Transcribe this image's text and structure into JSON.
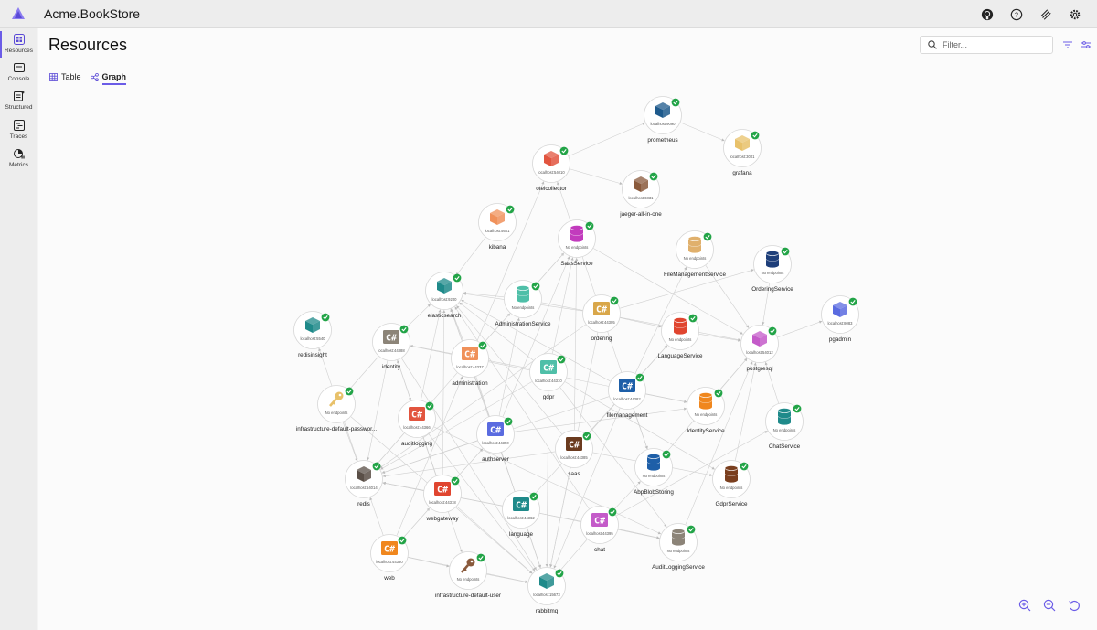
{
  "app": {
    "title": "Acme.BookStore"
  },
  "topbar": {
    "icons": [
      "github-icon",
      "help-icon",
      "feedback-icon",
      "settings-icon"
    ]
  },
  "sidebar": {
    "items": [
      {
        "label": "Resources",
        "icon": "resources-icon",
        "active": true
      },
      {
        "label": "Console",
        "icon": "console-icon",
        "active": false
      },
      {
        "label": "Structured",
        "icon": "structured-icon",
        "active": false
      },
      {
        "label": "Traces",
        "icon": "traces-icon",
        "active": false
      },
      {
        "label": "Metrics",
        "icon": "metrics-icon",
        "active": false
      }
    ]
  },
  "page": {
    "title": "Resources",
    "filter_placeholder": "Filter...",
    "tabs": [
      {
        "label": "Table",
        "icon": "table-icon",
        "active": false
      },
      {
        "label": "Graph",
        "icon": "graph-icon",
        "active": true
      }
    ]
  },
  "colors": {
    "accent": "#6b5ce7",
    "status_ok": "#22a447",
    "edge": "#d0d0d0"
  },
  "graph": {
    "nodes": [
      {
        "id": "prometheus",
        "label": "prometheus",
        "endpoint": "localhost:9090",
        "kind": "container",
        "color": "#1e5a8c"
      },
      {
        "id": "grafana",
        "label": "grafana",
        "endpoint": "localhost:3001",
        "kind": "container",
        "color": "#e8c16a"
      },
      {
        "id": "otelcollector",
        "label": "otelcollector",
        "endpoint": "localhost:54010",
        "kind": "container",
        "color": "#e2553f"
      },
      {
        "id": "jaeger",
        "label": "jaeger-all-in-one",
        "endpoint": "localhost:6831",
        "kind": "container",
        "color": "#8a5a3c"
      },
      {
        "id": "kibana",
        "label": "kibana",
        "endpoint": "localhost:5601",
        "kind": "container",
        "color": "#f0915a"
      },
      {
        "id": "saasservice",
        "label": "SaasService",
        "endpoint": "No endpoints",
        "kind": "database",
        "color": "#c23bbd"
      },
      {
        "id": "filemgmtsvc",
        "label": "FileManagementService",
        "endpoint": "No endpoints",
        "kind": "database",
        "color": "#e0b06c"
      },
      {
        "id": "orderingsvc",
        "label": "OrderingService",
        "endpoint": "No endpoints",
        "kind": "database",
        "color": "#1e3f7a"
      },
      {
        "id": "elasticsearch",
        "label": "elasticsearch",
        "endpoint": "localhost:9200",
        "kind": "container",
        "color": "#1f8a8a"
      },
      {
        "id": "adminsvc",
        "label": "AdministrationService",
        "endpoint": "No endpoints",
        "kind": "database",
        "color": "#4fbfa8"
      },
      {
        "id": "ordering",
        "label": "ordering",
        "endpoint": "localhost:44305",
        "kind": "project",
        "color": "#d9a74a"
      },
      {
        "id": "pgadmin",
        "label": "pgadmin",
        "endpoint": "localhost:8083",
        "kind": "container",
        "color": "#5a6be0"
      },
      {
        "id": "redisinsight",
        "label": "redisinsight",
        "endpoint": "localhost:5540",
        "kind": "container",
        "color": "#1f8a8a"
      },
      {
        "id": "identity",
        "label": "identity",
        "endpoint": "localhost:44388",
        "kind": "project",
        "color": "#8c8478"
      },
      {
        "id": "languagesvc",
        "label": "LanguageService",
        "endpoint": "No endpoints",
        "kind": "database",
        "color": "#e0452f"
      },
      {
        "id": "postgresql",
        "label": "postgresql",
        "endpoint": "localhost:54012",
        "kind": "container",
        "color": "#c45bc9"
      },
      {
        "id": "administration",
        "label": "administration",
        "endpoint": "localhost:44337",
        "kind": "project",
        "color": "#f0915a"
      },
      {
        "id": "gdpr",
        "label": "gdpr",
        "endpoint": "localhost:44310",
        "kind": "project",
        "color": "#4fbfa8"
      },
      {
        "id": "filemanagement",
        "label": "filemanagement",
        "endpoint": "localhost:44382",
        "kind": "project",
        "color": "#1e5fa8"
      },
      {
        "id": "infrapwd",
        "label": "infrastructure-default-passwor...",
        "endpoint": "No endpoints",
        "kind": "parameter",
        "color": "#e8c16a"
      },
      {
        "id": "identitysvc",
        "label": "IdentityService",
        "endpoint": "No endpoints",
        "kind": "database",
        "color": "#f0871e"
      },
      {
        "id": "chatsvc",
        "label": "ChatService",
        "endpoint": "No endpoints",
        "kind": "database",
        "color": "#1f8a8a"
      },
      {
        "id": "auditlogging",
        "label": "auditlogging",
        "endpoint": "localhost:44366",
        "kind": "project",
        "color": "#e2553f"
      },
      {
        "id": "authserver",
        "label": "authserver",
        "endpoint": "localhost:44350",
        "kind": "project",
        "color": "#5a6be0"
      },
      {
        "id": "saas",
        "label": "saas",
        "endpoint": "localhost:44385",
        "kind": "project",
        "color": "#6b3b1f"
      },
      {
        "id": "redis",
        "label": "redis",
        "endpoint": "localhost:54014",
        "kind": "container",
        "color": "#5a4f47"
      },
      {
        "id": "abpblob",
        "label": "AbpBlobStoring",
        "endpoint": "No endpoints",
        "kind": "database",
        "color": "#1e5fa8"
      },
      {
        "id": "gdprsvc",
        "label": "GdprService",
        "endpoint": "No endpoints",
        "kind": "database",
        "color": "#7a3f1f"
      },
      {
        "id": "webgateway",
        "label": "webgateway",
        "endpoint": "localhost:44318",
        "kind": "project",
        "color": "#e0452f"
      },
      {
        "id": "language",
        "label": "language",
        "endpoint": "localhost:44362",
        "kind": "project",
        "color": "#1f8a8a"
      },
      {
        "id": "chat",
        "label": "chat",
        "endpoint": "localhost:44395",
        "kind": "project",
        "color": "#c45bc9"
      },
      {
        "id": "auditsvc",
        "label": "AuditLoggingService",
        "endpoint": "No endpoints",
        "kind": "database",
        "color": "#8c8478"
      },
      {
        "id": "web",
        "label": "web",
        "endpoint": "localhost:44380",
        "kind": "project",
        "color": "#f0871e"
      },
      {
        "id": "infrauser",
        "label": "infrastructure-default-user",
        "endpoint": "No endpoints",
        "kind": "parameter",
        "color": "#8a5a3c"
      },
      {
        "id": "rabbitmq",
        "label": "rabbitmq",
        "endpoint": "localhost:15673",
        "kind": "container",
        "color": "#1f8a8a"
      }
    ],
    "edges": [
      [
        "otelcollector",
        "prometheus"
      ],
      [
        "otelcollector",
        "jaeger"
      ],
      [
        "prometheus",
        "grafana"
      ],
      [
        "kibana",
        "elasticsearch"
      ],
      [
        "postgresql",
        "pgadmin"
      ],
      [
        "redis",
        "redisinsight"
      ],
      [
        "saasservice",
        "postgresql"
      ],
      [
        "filemgmtsvc",
        "postgresql"
      ],
      [
        "orderingsvc",
        "postgresql"
      ],
      [
        "adminsvc",
        "postgresql"
      ],
      [
        "languagesvc",
        "postgresql"
      ],
      [
        "identitysvc",
        "postgresql"
      ],
      [
        "chatsvc",
        "postgresql"
      ],
      [
        "abpblob",
        "postgresql"
      ],
      [
        "gdprsvc",
        "postgresql"
      ],
      [
        "auditsvc",
        "postgresql"
      ],
      [
        "ordering",
        "orderingsvc"
      ],
      [
        "ordering",
        "rabbitmq"
      ],
      [
        "ordering",
        "redis"
      ],
      [
        "ordering",
        "elasticsearch"
      ],
      [
        "ordering",
        "otelcollector"
      ],
      [
        "identity",
        "identitysvc"
      ],
      [
        "identity",
        "rabbitmq"
      ],
      [
        "identity",
        "redis"
      ],
      [
        "identity",
        "elasticsearch"
      ],
      [
        "identity",
        "infrapwd"
      ],
      [
        "administration",
        "adminsvc"
      ],
      [
        "administration",
        "rabbitmq"
      ],
      [
        "administration",
        "redis"
      ],
      [
        "administration",
        "elasticsearch"
      ],
      [
        "administration",
        "otelcollector"
      ],
      [
        "gdpr",
        "gdprsvc"
      ],
      [
        "gdpr",
        "rabbitmq"
      ],
      [
        "gdpr",
        "redis"
      ],
      [
        "gdpr",
        "elasticsearch"
      ],
      [
        "gdpr",
        "saasservice"
      ],
      [
        "filemanagement",
        "filemgmtsvc"
      ],
      [
        "filemanagement",
        "rabbitmq"
      ],
      [
        "filemanagement",
        "redis"
      ],
      [
        "filemanagement",
        "abpblob"
      ],
      [
        "filemanagement",
        "elasticsearch"
      ],
      [
        "auditlogging",
        "auditsvc"
      ],
      [
        "auditlogging",
        "rabbitmq"
      ],
      [
        "auditlogging",
        "redis"
      ],
      [
        "auditlogging",
        "elasticsearch"
      ],
      [
        "auditlogging",
        "infrauser"
      ],
      [
        "authserver",
        "identitysvc"
      ],
      [
        "authserver",
        "rabbitmq"
      ],
      [
        "authserver",
        "redis"
      ],
      [
        "authserver",
        "elasticsearch"
      ],
      [
        "authserver",
        "adminsvc"
      ],
      [
        "saas",
        "saasservice"
      ],
      [
        "saas",
        "rabbitmq"
      ],
      [
        "saas",
        "redis"
      ],
      [
        "saas",
        "elasticsearch"
      ],
      [
        "saas",
        "languagesvc"
      ],
      [
        "webgateway",
        "rabbitmq"
      ],
      [
        "webgateway",
        "redis"
      ],
      [
        "webgateway",
        "elasticsearch"
      ],
      [
        "webgateway",
        "authserver"
      ],
      [
        "language",
        "languagesvc"
      ],
      [
        "language",
        "rabbitmq"
      ],
      [
        "language",
        "redis"
      ],
      [
        "language",
        "elasticsearch"
      ],
      [
        "chat",
        "chatsvc"
      ],
      [
        "chat",
        "rabbitmq"
      ],
      [
        "chat",
        "redis"
      ],
      [
        "chat",
        "elasticsearch"
      ],
      [
        "chat",
        "auditsvc"
      ],
      [
        "web",
        "webgateway"
      ],
      [
        "web",
        "rabbitmq"
      ],
      [
        "web",
        "redis"
      ],
      [
        "web",
        "authserver"
      ],
      [
        "web",
        "infrauser"
      ],
      [
        "infrapwd",
        "redis"
      ],
      [
        "infrauser",
        "rabbitmq"
      ],
      [
        "infrapwd",
        "rabbitmq"
      ],
      [
        "ordering",
        "abpblob"
      ],
      [
        "gdpr",
        "auditsvc"
      ],
      [
        "identity",
        "auditlogging"
      ],
      [
        "administration",
        "saasservice"
      ],
      [
        "filemanagement",
        "identitysvc"
      ],
      [
        "language",
        "auditsvc"
      ],
      [
        "saas",
        "gdprsvc"
      ],
      [
        "chat",
        "abpblob"
      ],
      [
        "authserver",
        "saasservice"
      ],
      [
        "webgateway",
        "identity"
      ],
      [
        "web",
        "administration"
      ],
      [
        "gdpr",
        "identity"
      ],
      [
        "adminsvc",
        "elasticsearch"
      ],
      [
        "ordering",
        "languagesvc"
      ],
      [
        "saasservice",
        "adminsvc"
      ]
    ]
  },
  "zoom": {
    "buttons": [
      "zoom-in-icon",
      "zoom-out-icon",
      "reset-view-icon"
    ]
  }
}
